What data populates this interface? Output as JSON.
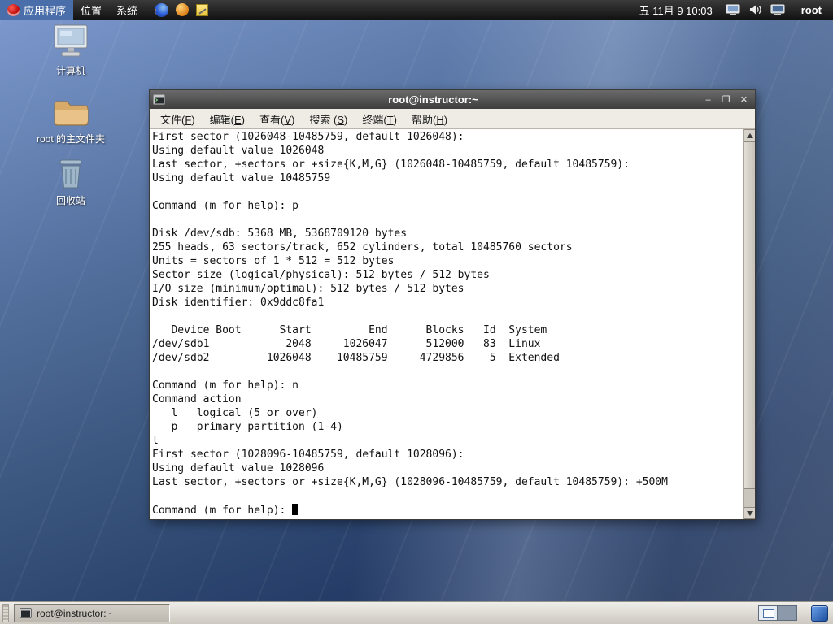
{
  "panel": {
    "menus": [
      {
        "label": "应用程序"
      },
      {
        "label": "位置"
      },
      {
        "label": "系统"
      }
    ],
    "clock": "五 11月  9 10:03",
    "user": "root"
  },
  "desktop": {
    "icons": [
      {
        "label": "计算机"
      },
      {
        "label": "root 的主文件夹"
      },
      {
        "label": "回收站"
      }
    ]
  },
  "terminal": {
    "title": "root@instructor:~",
    "menu": [
      "文件(F)",
      "编辑(E)",
      "查看(V)",
      "搜索 (S)",
      "终端(T)",
      "帮助(H)"
    ],
    "window_buttons": {
      "minimize": "–",
      "maximize": "❐",
      "close": "✕"
    },
    "lines": [
      "First sector (1026048-10485759, default 1026048):",
      "Using default value 1026048",
      "Last sector, +sectors or +size{K,M,G} (1026048-10485759, default 10485759):",
      "Using default value 10485759",
      "",
      "Command (m for help): p",
      "",
      "Disk /dev/sdb: 5368 MB, 5368709120 bytes",
      "255 heads, 63 sectors/track, 652 cylinders, total 10485760 sectors",
      "Units = sectors of 1 * 512 = 512 bytes",
      "Sector size (logical/physical): 512 bytes / 512 bytes",
      "I/O size (minimum/optimal): 512 bytes / 512 bytes",
      "Disk identifier: 0x9ddc8fa1",
      "",
      "   Device Boot      Start         End      Blocks   Id  System",
      "/dev/sdb1            2048     1026047      512000   83  Linux",
      "/dev/sdb2         1026048    10485759     4729856    5  Extended",
      "",
      "Command (m for help): n",
      "Command action",
      "   l   logical (5 or over)",
      "   p   primary partition (1-4)",
      "l",
      "First sector (1028096-10485759, default 1028096):",
      "Using default value 1028096",
      "Last sector, +sectors or +size{K,M,G} (1028096-10485759, default 10485759): +500M",
      "",
      "Command (m for help): "
    ]
  },
  "taskbar": {
    "task_label": "root@instructor:~"
  }
}
